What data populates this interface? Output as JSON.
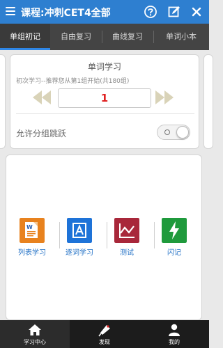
{
  "header": {
    "title": "课程:冲刺CET4全部",
    "icons": [
      "menu-icon",
      "help-icon",
      "edit-icon",
      "close-icon"
    ]
  },
  "tabs": [
    {
      "label": "单组初记",
      "active": true
    },
    {
      "label": "自由复习",
      "active": false
    },
    {
      "label": "曲线复习",
      "active": false
    },
    {
      "label": "单词小本",
      "active": false
    }
  ],
  "study": {
    "title": "单词学习",
    "description": "初次学习--推荐您从第1组开始(共180组)",
    "group_number": "1",
    "allow_jump_label": "允许分组跳跃",
    "allow_jump_enabled": false
  },
  "features": [
    {
      "label": "列表学习",
      "icon": "list-study-icon"
    },
    {
      "label": "逐词学习",
      "icon": "word-study-icon"
    },
    {
      "label": "测试",
      "icon": "test-icon"
    },
    {
      "label": "闪记",
      "icon": "flash-icon"
    }
  ],
  "bottom_nav": [
    {
      "label": "学习中心",
      "icon": "home-icon",
      "active": true
    },
    {
      "label": "发现",
      "icon": "discover-icon",
      "active": false
    },
    {
      "label": "我的",
      "icon": "user-icon",
      "active": false
    }
  ],
  "colors": {
    "header_bg": "#2e7fd0",
    "tab_bar_bg": "#444444",
    "tab_indicator": "#2e86e6",
    "group_number": "#e02020",
    "feature_label": "#1f6fc5",
    "list_icon": "#e8821e",
    "word_icon": "#1e73d8",
    "test_icon": "#a8273a",
    "flash_icon": "#1f9a3c",
    "bottom_bar_bg": "#1c1c1c"
  }
}
